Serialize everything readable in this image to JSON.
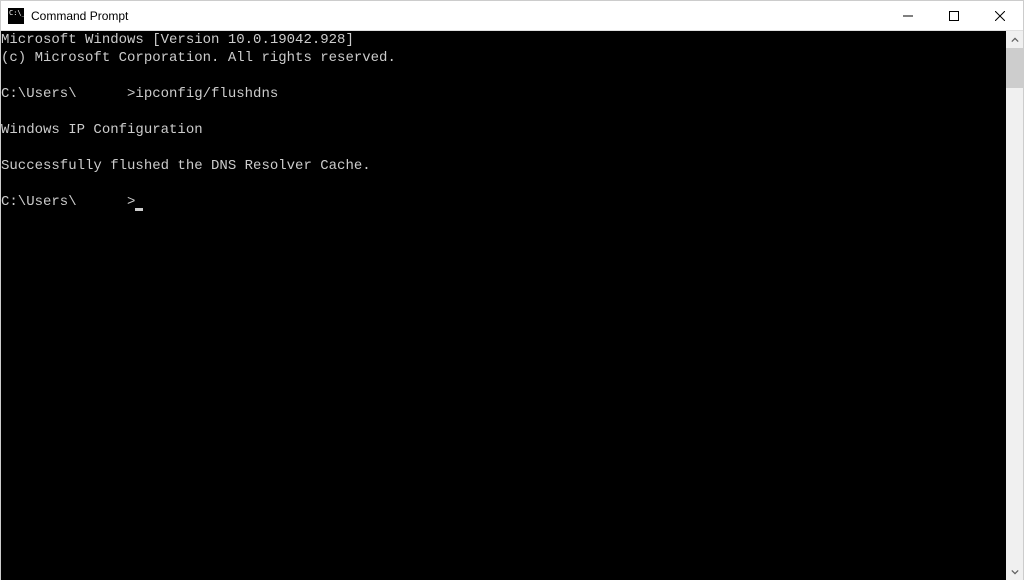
{
  "window": {
    "title": "Command Prompt"
  },
  "terminal": {
    "lines": [
      "Microsoft Windows [Version 10.0.19042.928]",
      "(c) Microsoft Corporation. All rights reserved.",
      "",
      "C:\\Users\\      >ipconfig/flushdns",
      "",
      "Windows IP Configuration",
      "",
      "Successfully flushed the DNS Resolver Cache.",
      "",
      "C:\\Users\\      >"
    ]
  }
}
